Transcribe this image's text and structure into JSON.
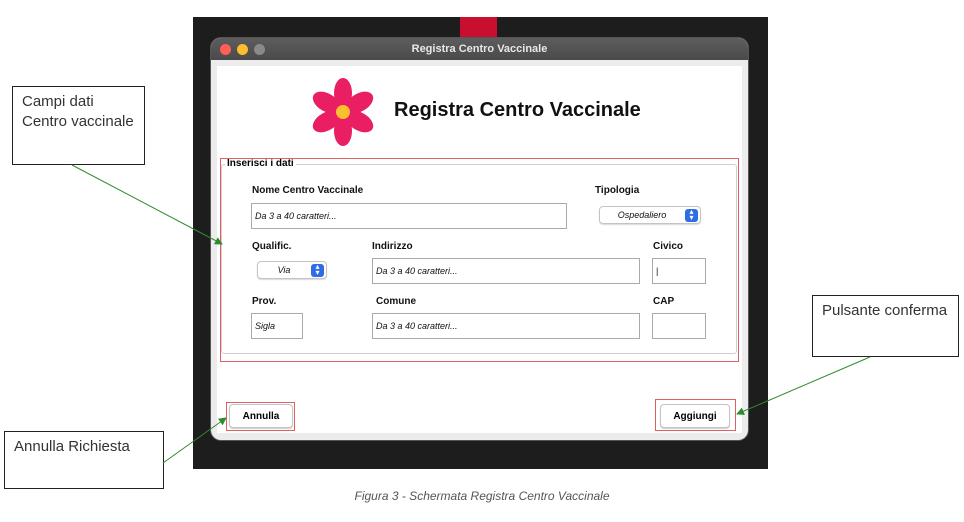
{
  "window": {
    "title": "Registra Centro Vaccinale"
  },
  "header": {
    "title": "Registra Centro Vaccinale"
  },
  "form": {
    "group_title": "Inserisci i dati",
    "nome": {
      "label": "Nome Centro Vaccinale",
      "placeholder": "Da 3 a 40 caratteri..."
    },
    "tipologia": {
      "label": "Tipologia",
      "value": "Ospedaliero"
    },
    "qualific": {
      "label": "Qualific.",
      "value": "Via"
    },
    "indirizzo": {
      "label": "Indirizzo",
      "placeholder": "Da 3 a 40 caratteri..."
    },
    "civico": {
      "label": "Civico",
      "value": "|"
    },
    "prov": {
      "label": "Prov.",
      "placeholder": "Sigla"
    },
    "comune": {
      "label": "Comune",
      "placeholder": "Da 3 a 40 caratteri..."
    },
    "cap": {
      "label": "CAP",
      "value": ""
    }
  },
  "buttons": {
    "annulla": "Annulla",
    "aggiungi": "Aggiungi"
  },
  "callouts": {
    "campi": "Campi dati Centro vaccinale",
    "annulla": "Annulla Richiesta",
    "pulsante": "Pulsante conferma"
  },
  "caption": "Figura 3 - Schermata Registra Centro Vaccinale",
  "colors": {
    "accent": "#2f6de6",
    "logo": "#e91e63",
    "annotation": "#e06060",
    "arrow": "#2e8b2e"
  }
}
